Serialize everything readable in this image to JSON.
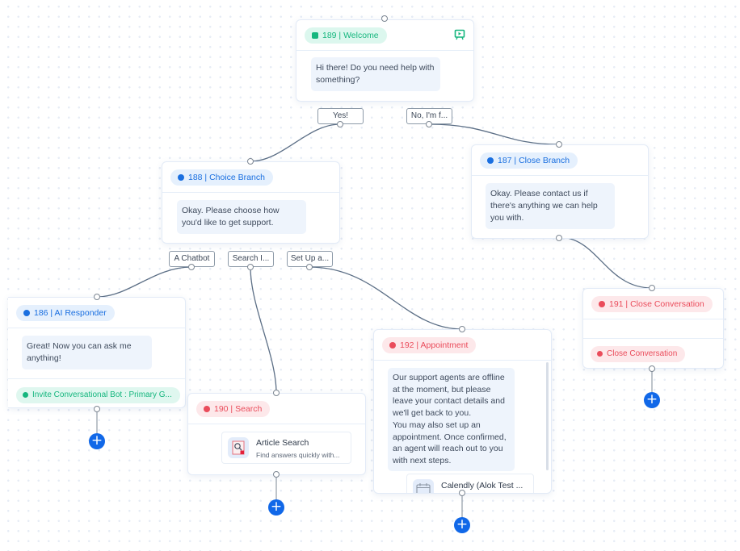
{
  "nodes": {
    "welcome": {
      "badge": "189 | Welcome",
      "badge_color": "#15b67e",
      "message": "Hi there! Do you need help with something?",
      "icon": "flow-start-icon",
      "choices": [
        "Yes!",
        "No, I'm f..."
      ]
    },
    "choice_branch": {
      "badge": "188 | Choice Branch",
      "badge_color": "#1a6fe0",
      "message": "Okay. Please choose how you'd like to get support.",
      "choices": [
        "A Chatbot",
        "Search I...",
        "Set Up a..."
      ]
    },
    "close_branch": {
      "badge": "187 | Close Branch",
      "badge_color": "#1a6fe0",
      "message": "Okay. Please contact us if there's anything we can help you with."
    },
    "ai_responder": {
      "badge": "186 | AI Responder",
      "badge_color": "#1a6fe0",
      "message": "Great! Now you can ask me anything!",
      "action": "Invite Conversational Bot : Primary G..."
    },
    "search": {
      "badge": "190 | Search",
      "badge_color": "#ea4c5b",
      "card_title": "Article Search",
      "card_subtitle": "Find answers quickly with..."
    },
    "appointment": {
      "badge": "192 | Appointment",
      "badge_color": "#ea4c5b",
      "message_lines": [
        "Our support agents are offline",
        "at the moment, but please",
        "leave your contact details and",
        "we'll get back to you.",
        "You may also set up an",
        "appointment. Once confirmed,",
        "an agent will reach out to you",
        "with next steps."
      ],
      "card_title": "Calendly (Alok Test ..."
    },
    "close_conversation": {
      "badge": "191 | Close Conversation",
      "badge_color": "#ea4c5b",
      "action": "Close Conversation"
    }
  },
  "add_button_label": "+"
}
